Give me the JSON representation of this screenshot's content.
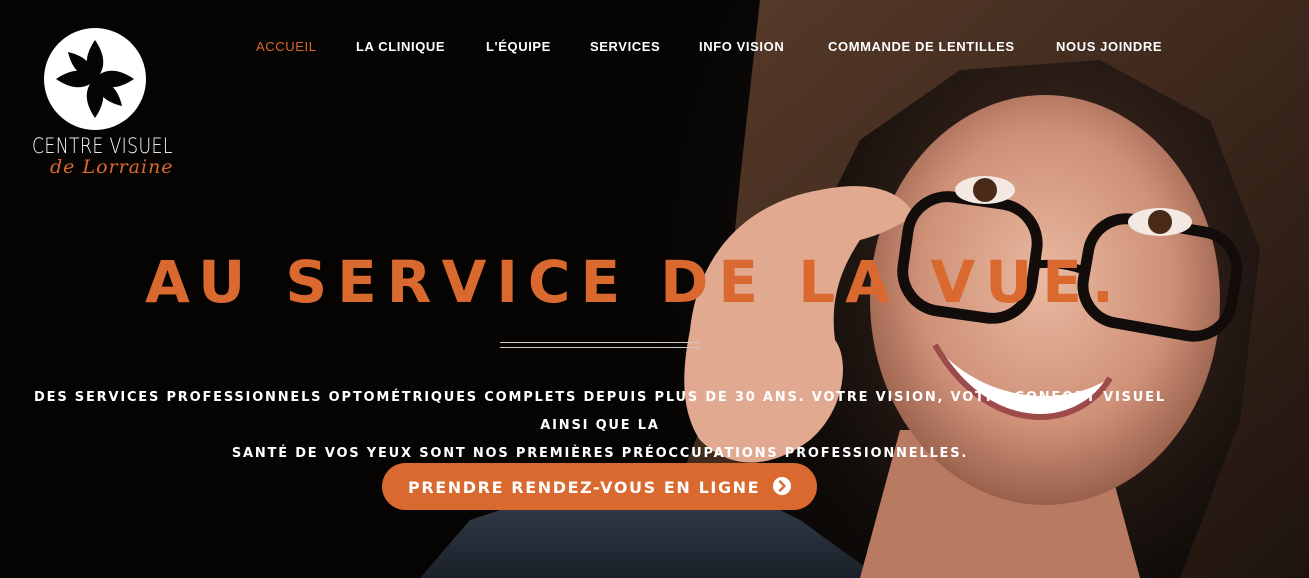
{
  "brand": {
    "name": "CENTRE VISUEL",
    "subtitle": "de Lorraine"
  },
  "nav": {
    "items": [
      {
        "label": "ACCUEIL",
        "active": true
      },
      {
        "label": "LA CLINIQUE",
        "active": false
      },
      {
        "label": "L'ÉQUIPE",
        "active": false
      },
      {
        "label": "SERVICES",
        "active": false
      },
      {
        "label": "INFO VISION",
        "active": false
      },
      {
        "label": "COMMANDE DE LENTILLES",
        "active": false
      },
      {
        "label": "NOUS JOINDRE",
        "active": false
      }
    ]
  },
  "hero": {
    "headline": "AU SERVICE DE LA VUE.",
    "tagline_line1": "DES SERVICES PROFESSIONNELS OPTOMÉTRIQUES COMPLETS DEPUIS PLUS DE 30 ANS. VOTRE VISION, VOTRE CONFORT VISUEL AINSI QUE LA",
    "tagline_line2": "SANTÉ DE VOS YEUX SONT NOS PREMIÈRES PRÉOCCUPATIONS PROFESSIONNELLES.",
    "cta_label": "PRENDRE RENDEZ-VOUS EN LIGNE",
    "cta_icon": "chevron-right-circle-icon",
    "background_image": "woman-with-glasses-photo"
  },
  "colors": {
    "accent": "#d9692e",
    "background": "#050403",
    "text": "#ffffff"
  }
}
